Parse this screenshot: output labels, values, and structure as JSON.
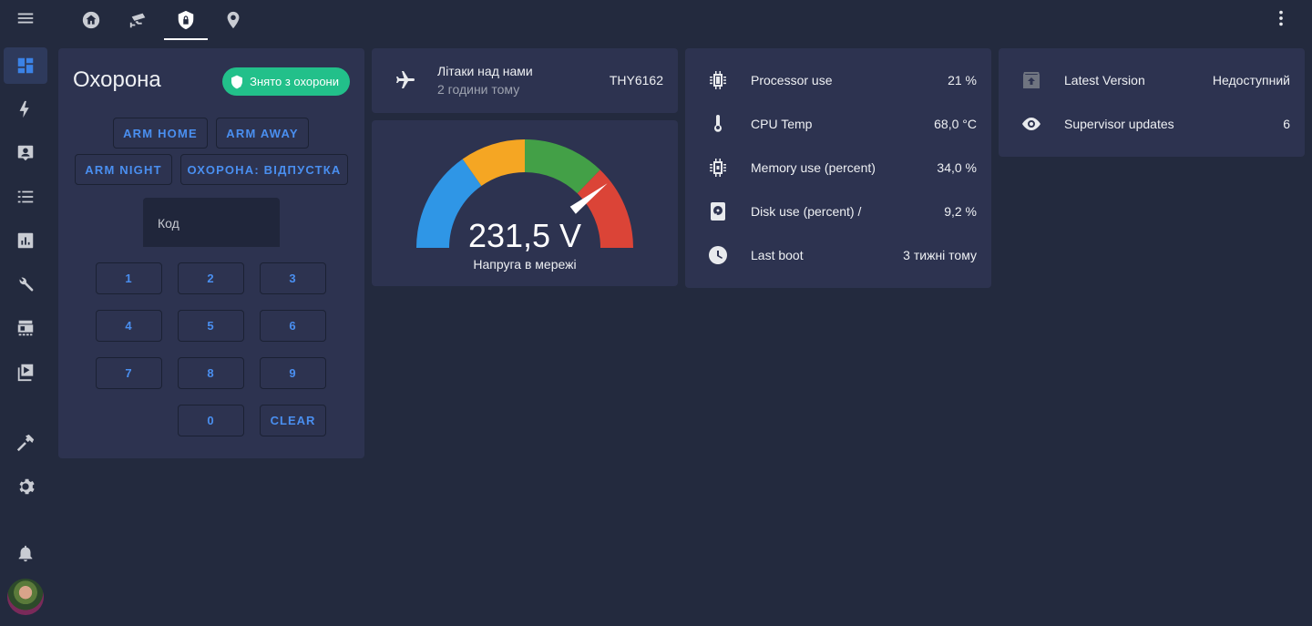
{
  "tabs": [
    "home-icon",
    "cctv-icon",
    "shield-lock-icon",
    "map-marker-icon"
  ],
  "sidebar": [
    "dashboard-icon",
    "energy-icon",
    "logbook-icon",
    "history-icon",
    "chart-icon",
    "wrench-icon",
    "hacs-icon",
    "media-icon",
    "hammer-icon",
    "settings-icon",
    "bell-icon"
  ],
  "alarm": {
    "title": "Охорона",
    "state_badge": "Знято з охорони",
    "actions": [
      "ARM HOME",
      "ARM AWAY",
      "ARM NIGHT",
      "ОХОРОНА: ВІДПУСТКА"
    ],
    "code_label": "Код",
    "keypad": [
      "1",
      "2",
      "3",
      "4",
      "5",
      "6",
      "7",
      "8",
      "9",
      "0",
      "CLEAR"
    ]
  },
  "flights": {
    "name": "Літаки над нами",
    "time": "2 години тому",
    "value": "THY6162"
  },
  "gauge": {
    "value": "231,5 V",
    "name": "Напруга в мережі",
    "colors": [
      "#2f96e6",
      "#f5a623",
      "#43a047",
      "#db4437"
    ]
  },
  "system": [
    {
      "icon": "chip-icon",
      "name": "Processor use",
      "value": "21 %"
    },
    {
      "icon": "thermometer-icon",
      "name": "CPU Temp",
      "value": "68,0 °C"
    },
    {
      "icon": "memory-icon",
      "name": "Memory use (percent)",
      "value": "34,0 %"
    },
    {
      "icon": "harddisk-icon",
      "name": "Disk use (percent) /",
      "value": "9,2 %"
    },
    {
      "icon": "clock-icon",
      "name": "Last boot",
      "value": "3 тижні тому"
    }
  ],
  "supervisor": [
    {
      "icon": "package-up-icon",
      "name": "Latest Version",
      "value": "Недоступний"
    },
    {
      "icon": "eye-icon",
      "name": "Supervisor updates",
      "value": "6"
    }
  ]
}
